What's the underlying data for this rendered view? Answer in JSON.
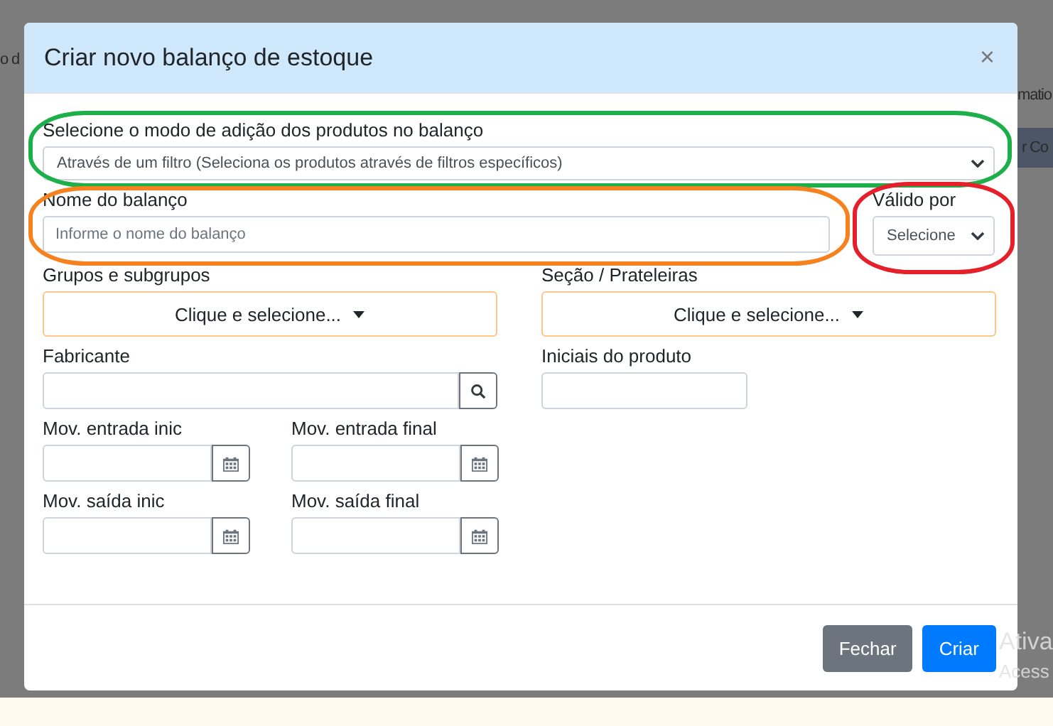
{
  "background": {
    "texts": [
      "o d",
      "matio",
      "r Co"
    ]
  },
  "dialog": {
    "title": "Criar novo balanço de estoque",
    "close": "×"
  },
  "mode": {
    "label": "Selecione o modo de adição dos produtos no balanço",
    "value": "Através de um filtro (Seleciona os produtos através de filtros específicos)"
  },
  "name": {
    "label": "Nome do balanço",
    "placeholder": "Informe o nome do balanço"
  },
  "valid_for": {
    "label": "Válido por",
    "value": "Selecione"
  },
  "highlights": [
    {
      "color": "#1db04a"
    },
    {
      "color": "#f5821f"
    },
    {
      "color": "#e5202a"
    }
  ],
  "groups": {
    "label": "Grupos e subgrupos",
    "button": "Clique e selecione..."
  },
  "sections": {
    "label": "Seção / Prateleiras",
    "button": "Clique e selecione..."
  },
  "manufacturer": {
    "label": "Fabricante"
  },
  "initials": {
    "label": "Iniciais do produto"
  },
  "dates": [
    {
      "label": "Mov. entrada inic"
    },
    {
      "label": "Mov. entrada final"
    },
    {
      "label": "Mov. saída inic"
    },
    {
      "label": "Mov. saída final"
    }
  ],
  "footer": {
    "buttons": [
      {
        "label": "Fechar",
        "kind": "secondary"
      },
      {
        "label": "Criar",
        "kind": "primary"
      }
    ]
  },
  "os_notice": [
    "Ativa",
    "Acess"
  ]
}
